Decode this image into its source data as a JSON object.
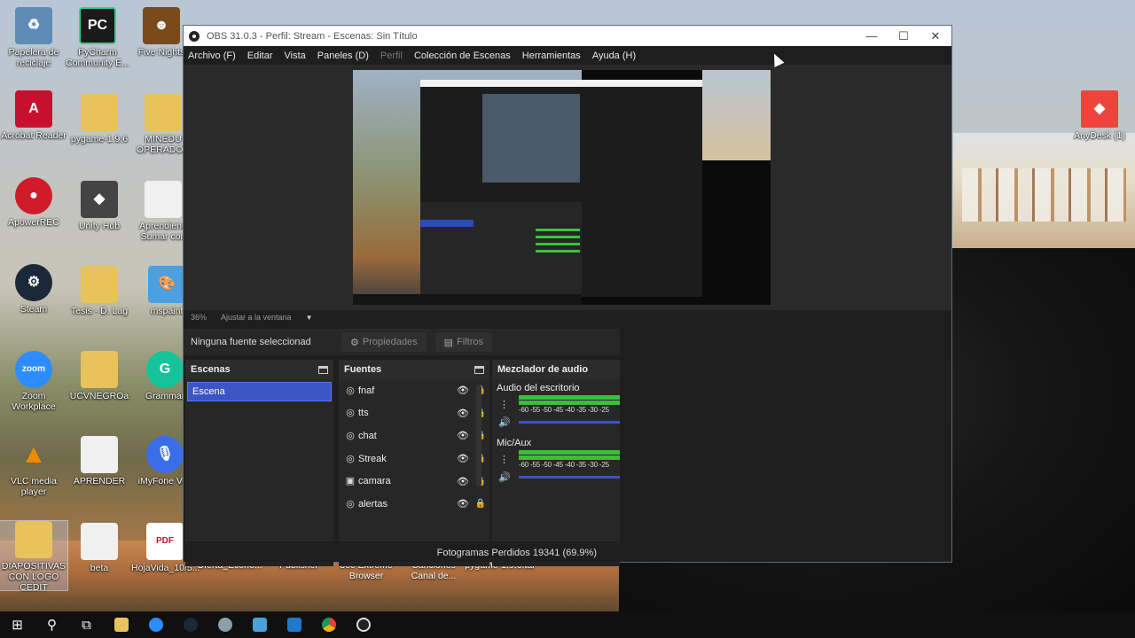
{
  "desktop": {
    "icons": [
      {
        "label": "Papelera de reciclaje",
        "icon": "recycle-bin-icon",
        "color": "#5f8bb8"
      },
      {
        "label": "PyCharm Community E...",
        "icon": "pycharm-icon",
        "color": "#1a1a1a"
      },
      {
        "label": "Five Nights",
        "icon": "game-icon",
        "color": "#7a4a1a"
      },
      {
        "label": "Acrobat Reader",
        "icon": "acrobat-icon",
        "color": "#c8102e"
      },
      {
        "label": "pygame-1.9.6",
        "icon": "folder-icon",
        "color": "#e8c25a"
      },
      {
        "label": "MINEDU OPERADOR",
        "icon": "folder-icon",
        "color": "#e8c25a"
      },
      {
        "label": "ApowerREC",
        "icon": "apowerrec-icon",
        "color": "#d01c2a"
      },
      {
        "label": "Unity Hub",
        "icon": "unity-icon",
        "color": "#444444"
      },
      {
        "label": "Aprendiend Sumar con",
        "icon": "document-icon",
        "color": "#f0f0f0"
      },
      {
        "label": "Steam",
        "icon": "steam-icon",
        "color": "#1b2838"
      },
      {
        "label": "Tesis - D. Lag",
        "icon": "folder-icon",
        "color": "#e8c25a"
      },
      {
        "label": "mspaint",
        "icon": "paint-icon",
        "color": "#4aa0e0"
      },
      {
        "label": "Zoom Workplace",
        "icon": "zoom-icon",
        "color": "#2d8cff"
      },
      {
        "label": "UCVNEGROa",
        "icon": "folder-icon",
        "color": "#e8c25a"
      },
      {
        "label": "Grammar",
        "icon": "grammarly-icon",
        "color": "#15c39a"
      },
      {
        "label": "VLC media player",
        "icon": "vlc-icon",
        "color": "#f08a00"
      },
      {
        "label": "APRENDER",
        "icon": "document-icon",
        "color": "#f0f0f0"
      },
      {
        "label": "iMyFone Vox",
        "icon": "imyfone-icon",
        "color": "#3a6ee8"
      },
      {
        "label": "DIAPOSITIVAS CON LOGO CEDIT",
        "icon": "folder-icon",
        "color": "#e8c25a"
      },
      {
        "label": "beta",
        "icon": "document-icon",
        "color": "#f0f0f0"
      },
      {
        "label": "HojaVida_10/5...",
        "icon": "pdf-icon",
        "color": "#c8102e"
      },
      {
        "label": "AnyDesk (1)",
        "icon": "anydesk-icon",
        "color": "#ef443b"
      }
    ],
    "bottom_labels": [
      "Oferta_Econo...",
      "Publisher",
      "360 Extreme Browser",
      "Canciones Canal de...",
      "pygame-1.9.6.tar"
    ]
  },
  "obs": {
    "title": "OBS 31.0.3 - Perfil: Stream - Escenas: Sin Título",
    "menu": [
      "Archivo (F)",
      "Editar",
      "Vista",
      "Paneles (D)",
      "Perfil",
      "Colección de Escenas",
      "Herramientas",
      "Ayuda (H)"
    ],
    "zoom": "36%",
    "fit_label": "Ajustar a la ventana",
    "no_source": "Ninguna fuente seleccionad",
    "properties": "Propiedades",
    "filters": "Filtros",
    "scenes_title": "Escenas",
    "scenes": [
      "Escena"
    ],
    "sources_title": "Fuentes",
    "sources": [
      {
        "name": "fnaf",
        "icon": "browser-source-icon"
      },
      {
        "name": "tts",
        "icon": "browser-source-icon"
      },
      {
        "name": "chat",
        "icon": "browser-source-icon"
      },
      {
        "name": "Streak",
        "icon": "browser-source-icon"
      },
      {
        "name": "camara",
        "icon": "camera-icon"
      },
      {
        "name": "alertas",
        "icon": "browser-source-icon"
      }
    ],
    "mixer_title": "Mezclador de audio",
    "mixer": [
      {
        "name": "Audio del escritorio",
        "scale": "-60 -55 -50 -45 -40 -35 -30 -25"
      },
      {
        "name": "Mic/Aux",
        "scale": "-60 -55 -50 -45 -40 -35 -30 -25"
      }
    ],
    "status": "Fotogramas Perdidos 19341 (69.9%)",
    "accent": "#3c55c4"
  },
  "taskbar": {
    "items": [
      "start",
      "search",
      "task-view",
      "file-explorer",
      "zoom",
      "steam",
      "pinned-app",
      "pinned-app-2",
      "vscode",
      "chrome",
      "obs"
    ]
  }
}
